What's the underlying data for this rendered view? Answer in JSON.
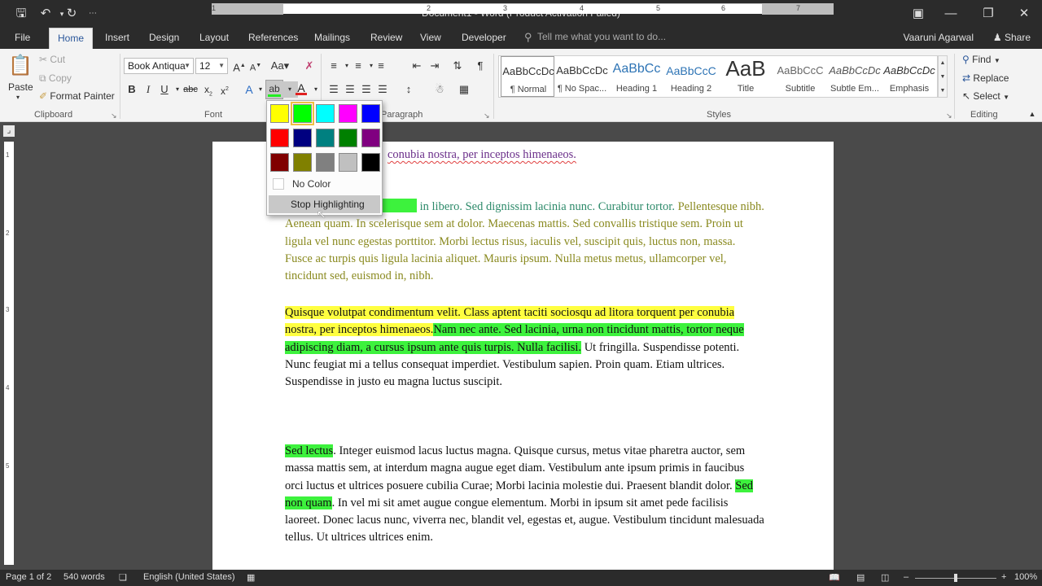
{
  "window": {
    "title": "Document1 - Word (Product Activation Failed)",
    "undo_icon": "undo-icon",
    "save_icon": "save-icon",
    "redo_icon": "redo-icon"
  },
  "tabs": {
    "file": "File",
    "home": "Home",
    "insert": "Insert",
    "design": "Design",
    "layout": "Layout",
    "references": "References",
    "mailings": "Mailings",
    "review": "Review",
    "view": "View",
    "developer": "Developer",
    "tellme": "Tell me what you want to do...",
    "user": "Vaaruni Agarwal",
    "share": "Share"
  },
  "clipboard": {
    "paste": "Paste",
    "cut": "Cut",
    "copy": "Copy",
    "format_painter": "Format Painter",
    "label": "Clipboard"
  },
  "font": {
    "name": "Book Antiqua",
    "size": "12",
    "label": "Font"
  },
  "paragraph": {
    "label": "Paragraph"
  },
  "styles": {
    "label": "Styles",
    "items": [
      {
        "preview": "AaBbCcDc",
        "name": "¶ Normal"
      },
      {
        "preview": "AaBbCcDc",
        "name": "¶ No Spac..."
      },
      {
        "preview": "AaBbCc",
        "name": "Heading 1"
      },
      {
        "preview": "AaBbCcC",
        "name": "Heading 2"
      },
      {
        "preview": "AaB",
        "name": "Title"
      },
      {
        "preview": "AaBbCcC",
        "name": "Subtitle"
      },
      {
        "preview": "AaBbCcDc",
        "name": "Subtle Em..."
      },
      {
        "preview": "AaBbCcDc",
        "name": "Emphasis"
      }
    ]
  },
  "editing": {
    "find": "Find",
    "replace": "Replace",
    "select": "Select",
    "label": "Editing"
  },
  "ruler": {
    "numbers": [
      "1",
      "2",
      "3",
      "4",
      "5",
      "6",
      "7"
    ],
    "vnumbers": [
      "1",
      "2",
      "3",
      "4",
      "5"
    ]
  },
  "highlight_menu": {
    "colors": [
      "#ffff00",
      "#00ff00",
      "#00ffff",
      "#ff00ff",
      "#0000ff",
      "#ff0000",
      "#000080",
      "#008080",
      "#008000",
      "#800080",
      "#800000",
      "#808000",
      "#808080",
      "#c0c0c0",
      "#000000"
    ],
    "selected_index": 1,
    "no_color": "No Color",
    "stop_highlighting": "Stop Highlighting"
  },
  "document": {
    "p0_line": "conubia nostra, per inceptos himenaeos.",
    "p1_tail": " in libero. Sed dignissim lacinia nunc. Curabitur tortor.",
    "p1_rest": "Pellentesque nibh. Aenean quam. In scelerisque sem at dolor. Maecenas mattis. Sed convallis tristique sem. Proin ut ligula vel nunc egestas porttitor. Morbi lectus risus, iaculis vel, suscipit quis, luctus non, massa. Fusce ac turpis quis ligula lacinia aliquet. Mauris ipsum. Nulla metus metus, ullamcorper vel, tincidunt sed, euismod in, nibh.",
    "p2_yellow": "Quisque volutpat condimentum velit. Class aptent taciti sociosqu ad litora torquent per conubia nostra, per inceptos himenaeos.",
    "p2_green": "Nam nec ante. Sed lacinia, urna non tincidunt mattis, tortor neque adipiscing diam, a cursus ipsum ante quis turpis. Nulla facilisi.",
    "p2_plain": " Ut fringilla. Suspendisse potenti. Nunc feugiat mi a tellus consequat imperdiet. Vestibulum sapien. Proin quam. Etiam ultrices. Suspendisse in justo eu magna luctus suscipit.",
    "p3_green1": "Sed lectus",
    "p3_plain1": ". Integer euismod lacus luctus magna. Quisque cursus, metus vitae pharetra auctor, sem massa mattis sem, at interdum magna augue eget diam. Vestibulum ante ipsum primis in faucibus orci luctus et ultrices posuere cubilia Curae; Morbi lacinia molestie dui. Praesent blandit dolor. ",
    "p3_green2": "Sed non quam",
    "p3_plain2": ". In vel mi sit amet augue congue elementum. Morbi in ipsum sit amet pede facilisis laoreet. Donec lacus nunc, viverra nec, blandit vel, egestas et, augue. Vestibulum tincidunt malesuada tellus. Ut ultrices ultrices enim."
  },
  "status": {
    "page": "Page 1 of 2",
    "words": "540 words",
    "language": "English (United States)",
    "zoom": "100%"
  }
}
